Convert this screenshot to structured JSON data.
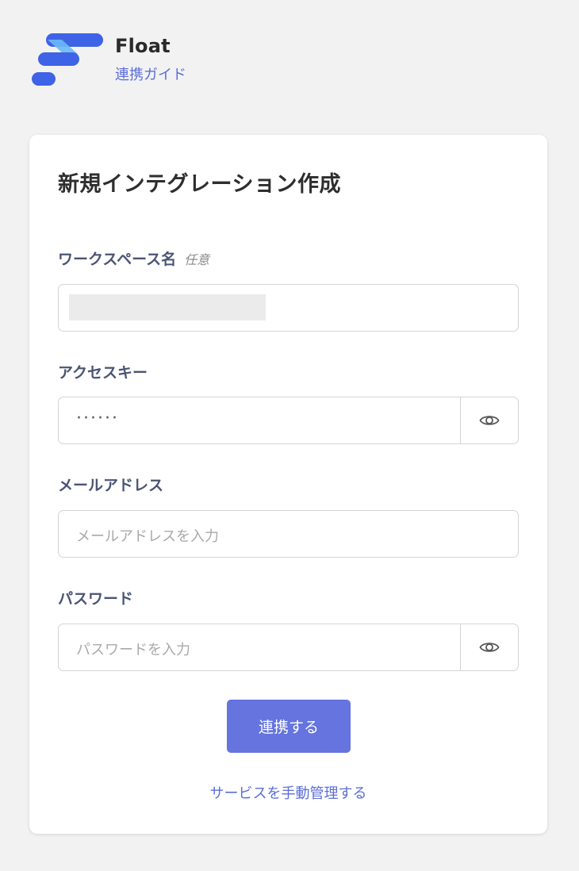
{
  "brand": {
    "name": "Float",
    "subtitle": "連携ガイド",
    "colors": {
      "primary": "#3f63e6",
      "light": "#6bb8f5"
    }
  },
  "card": {
    "title": "新規インテグレーション作成"
  },
  "form": {
    "workspace": {
      "label": "ワークスペース名",
      "optional": "任意",
      "value": ""
    },
    "access_key": {
      "label": "アクセスキー",
      "value": "······",
      "toggle_icon": "eye-icon"
    },
    "email": {
      "label": "メールアドレス",
      "placeholder": "メールアドレスを入力"
    },
    "password": {
      "label": "パスワード",
      "placeholder": "パスワードを入力",
      "toggle_icon": "eye-icon"
    }
  },
  "actions": {
    "submit_label": "連携する",
    "manual_link": "サービスを手動管理する"
  },
  "colors": {
    "background": "#f2f2f2",
    "accent": "#6574de",
    "link": "#5c6ed8",
    "label": "#4a5474"
  }
}
